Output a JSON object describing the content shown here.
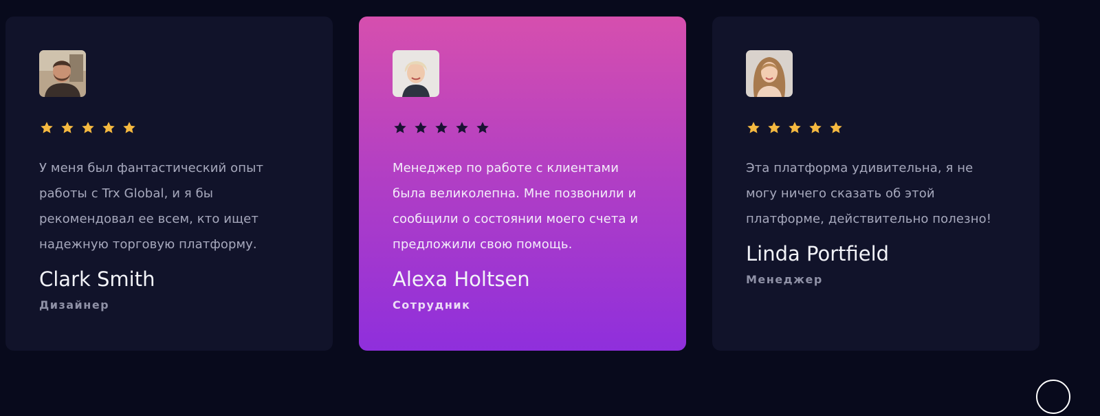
{
  "testimonials": [
    {
      "avatar_icon": "man-portrait-avatar",
      "rating": 5,
      "star_color": "#f5b940",
      "quote": "У меня был фантастический опыт работы с Trx Global, и я бы рекомендовал ее всем, кто ищет надежную торговую платформу.",
      "name": "Clark Smith",
      "role": "Дизайнер"
    },
    {
      "avatar_icon": "woman-short-hair-avatar",
      "rating": 5,
      "star_color": "#1a1233",
      "quote": "Менеджер по работе с клиентами была великолепна. Мне позвонили и сообщили о состоянии моего счета и предложили свою помощь.",
      "name": "Alexa Holtsen",
      "role": "Сотрудник"
    },
    {
      "avatar_icon": "woman-long-hair-avatar",
      "rating": 5,
      "star_color": "#f5b940",
      "quote": "Эта платформа удивительна, я не могу ничего сказать об этой платформе, действительно полезно!",
      "name": "Linda Portfield",
      "role": "Менеджер"
    }
  ],
  "colors": {
    "page_background": "#080a1c",
    "card_background": "#11132a",
    "highlight_gradient_top": "#d64fae",
    "highlight_gradient_bottom": "#8f2fdc"
  }
}
